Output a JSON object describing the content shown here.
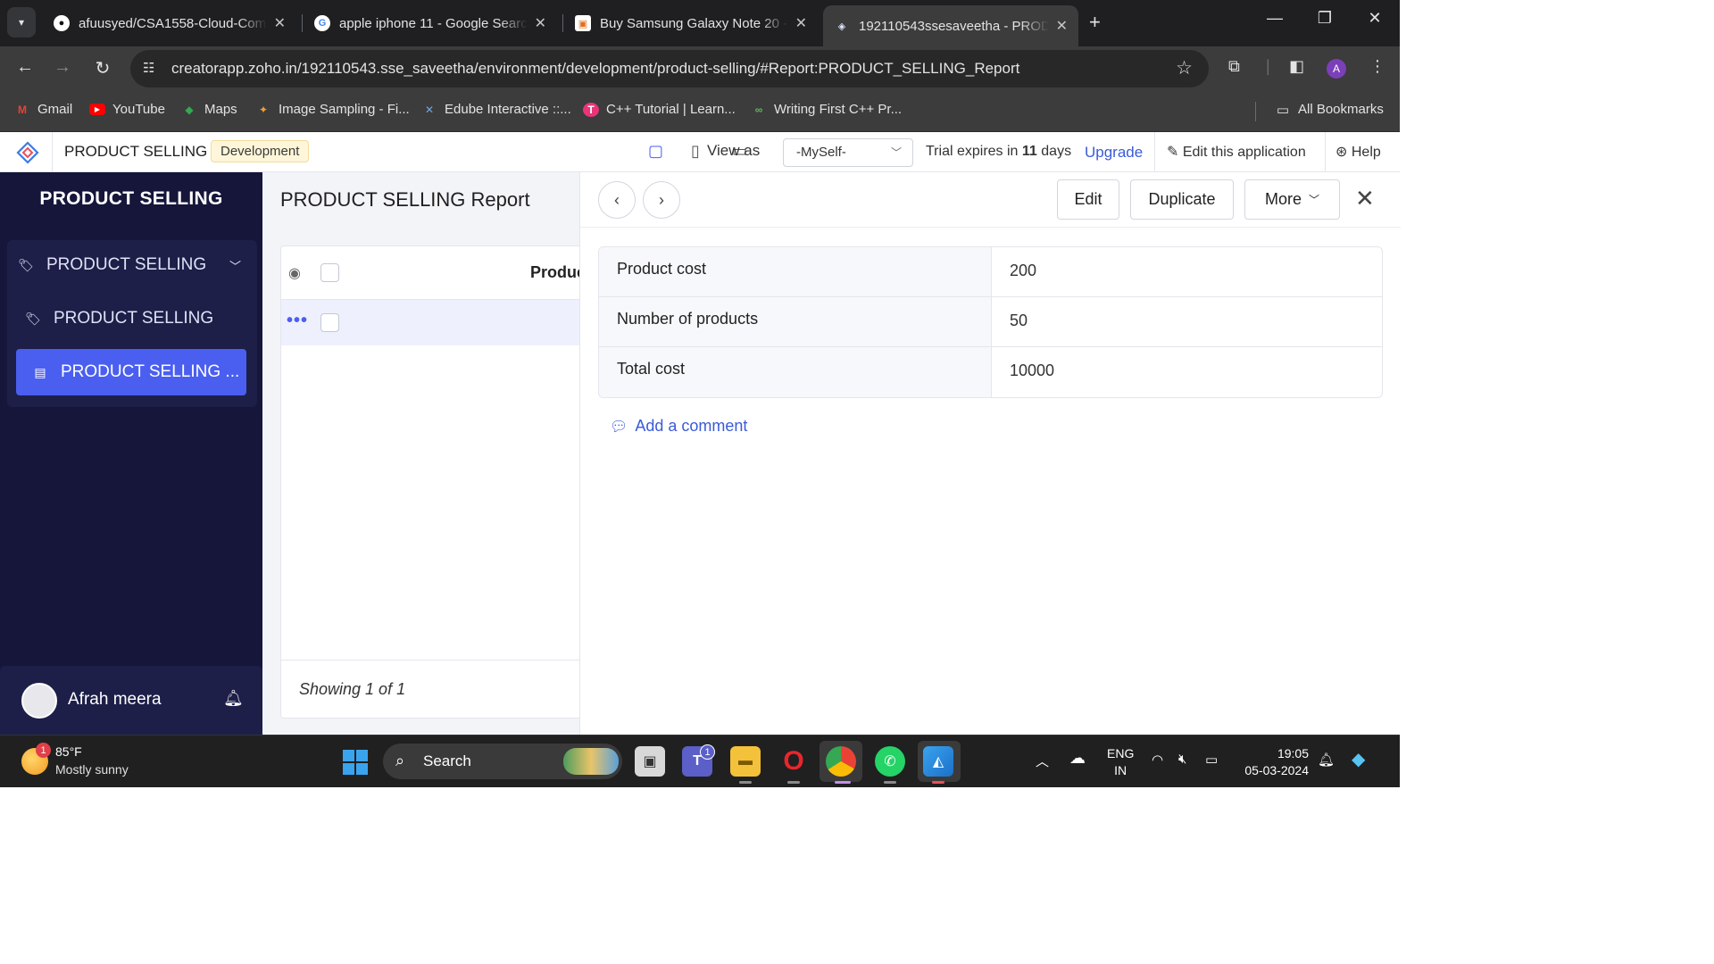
{
  "browser": {
    "tabs": [
      {
        "title": "afuusyed/CSA1558-Cloud-Com",
        "icon": "github-icon"
      },
      {
        "title": "apple iphone 11 - Google Searc",
        "icon": "google-icon"
      },
      {
        "title": "Buy Samsung Galaxy Note 20 -",
        "icon": "shop-icon"
      },
      {
        "title": "192110543ssesaveetha - PRODU",
        "icon": "zoho-creator-icon"
      }
    ],
    "url": "creatorapp.zoho.in/192110543.sse_saveetha/environment/development/product-selling/#Report:PRODUCT_SELLING_Report",
    "profile_initial": "A",
    "bookmarks": [
      "Gmail",
      "YouTube",
      "Maps",
      "Image Sampling - Fi...",
      "Edube Interactive ::...",
      "C++ Tutorial | Learn...",
      "Writing First C++ Pr..."
    ],
    "all_bookmarks": "All Bookmarks"
  },
  "appbar": {
    "app_name": "PRODUCT SELLING",
    "environment": "Development",
    "view_as": "View as",
    "view_as_value": "-MySelf-",
    "trial_prefix": "Trial expires in",
    "trial_days": "11",
    "trial_suffix": "days",
    "upgrade": "Upgrade",
    "edit_app": "Edit this application",
    "help": "Help"
  },
  "sidebar": {
    "title": "PRODUCT SELLING",
    "items": [
      {
        "label": "PRODUCT SELLING"
      },
      {
        "label": "PRODUCT SELLING"
      },
      {
        "label": "PRODUCT SELLING ..."
      }
    ],
    "user_name": "Afrah meera"
  },
  "report": {
    "title": "PRODUCT SELLING Report",
    "column_header": "Produc",
    "showing": "Showing 1 of 1"
  },
  "detail": {
    "buttons": {
      "edit": "Edit",
      "duplicate": "Duplicate",
      "more": "More"
    },
    "fields": [
      {
        "label": "Product cost",
        "value": "200"
      },
      {
        "label": "Number of products",
        "value": "50"
      },
      {
        "label": "Total cost",
        "value": "10000"
      }
    ],
    "add_comment": "Add a comment"
  },
  "taskbar": {
    "weather_temp": "85°F",
    "weather_desc": "Mostly sunny",
    "weather_badge": "1",
    "search": "Search",
    "teams_badge": "1",
    "lang_top": "ENG",
    "lang_bottom": "IN",
    "time": "19:05",
    "date": "05-03-2024"
  },
  "colors": {
    "accent": "#4a5ff0",
    "sidebar_bg": "#15163a",
    "link": "#3a5bd9"
  }
}
